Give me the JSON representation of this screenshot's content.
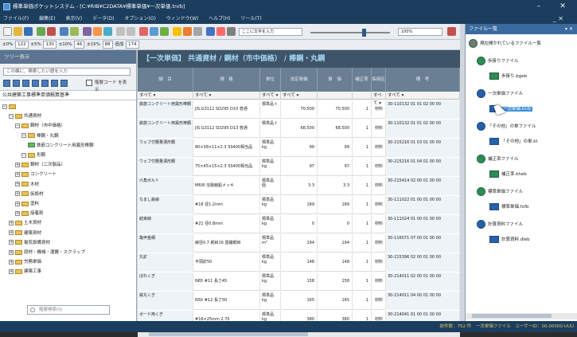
{
  "window": {
    "title": "標準単価ポケットシステム - [C:¥RIB¥C2DATA¥標準単価¥一次単価.tnrb]",
    "minimize": "–",
    "close": "✕"
  },
  "menu": [
    "ファイル(F)",
    "編集(E)",
    "表示(V)",
    "データ(D)",
    "オプション(O)",
    "ウィンドウ(W)",
    "ヘルプ(H)",
    "ツール(T)"
  ],
  "menu_close": "_ ✕",
  "toolbar": {
    "search_box": "ここに文字を入力",
    "zoom": "100%"
  },
  "toolbar2": {
    "items": [
      "±0%",
      "122",
      "±5%",
      "130",
      "±10%",
      "46",
      "±15%",
      "88",
      "追加",
      "174"
    ]
  },
  "left_pane": {
    "header": "ツリー表示",
    "filter_placeholder": "この欄に、検索したい語を入力",
    "filter_button": "検索",
    "code_checkbox_label": "階層コード を表示",
    "title": "公共建築工事標準単価積算基準",
    "search_placeholder": "階層検索(S)",
    "tree": [
      {
        "label": "",
        "level": 0,
        "kind": "root"
      },
      {
        "label": "共通資材",
        "level": 1,
        "kind": "folder"
      },
      {
        "label": "鋼材（市中価格）",
        "level": 2,
        "kind": "folder"
      },
      {
        "label": "棒鋼・丸鋼",
        "level": 3,
        "kind": "folder"
      },
      {
        "label": "鉄筋コンクリート用異形棒鋼",
        "level": 4,
        "kind": "leaf"
      },
      {
        "label": "形鋼",
        "level": 3,
        "kind": "folder"
      },
      {
        "label": "鋼材（二次製品）",
        "level": 2,
        "kind": "folder"
      },
      {
        "label": "コンクリート",
        "level": 2,
        "kind": "folder"
      },
      {
        "label": "木材",
        "level": 2,
        "kind": "folder"
      },
      {
        "label": "仮設材",
        "level": 2,
        "kind": "folder"
      },
      {
        "label": "塗料",
        "level": 2,
        "kind": "folder"
      },
      {
        "label": "接着剤",
        "level": 2,
        "kind": "folder"
      },
      {
        "label": "土木資材",
        "level": 1,
        "kind": "folder"
      },
      {
        "label": "建築資材",
        "level": 1,
        "kind": "folder"
      },
      {
        "label": "電気設備資材",
        "level": 1,
        "kind": "folder"
      },
      {
        "label": "原材・機械・運搬・スクラップ",
        "level": 1,
        "kind": "folder"
      },
      {
        "label": "労務単価",
        "level": 1,
        "kind": "folder"
      },
      {
        "label": "建築工事",
        "level": 1,
        "kind": "folder"
      }
    ]
  },
  "main": {
    "header": "【一次単価】 共通資材 / 鋼材（市中価格） / 棒鋼・丸鋼",
    "columns": [
      "細　目",
      "規　格",
      "単位",
      "決定単価",
      "単　価",
      "補正率",
      "採用区分",
      "備　考"
    ],
    "filters": [
      "すべて",
      "すべて",
      "すべて",
      "すべて",
      "",
      "",
      "すべて",
      "すべて"
    ],
    "rows": [
      {
        "name": "鉄筋コンクリート用異形棒鋼",
        "spec": "JIS G3112 SD295 D10 普通",
        "unit": "標準品 t",
        "decided": "70,500",
        "price": "70,500",
        "rate": "1",
        "adopt": "材料",
        "note": "30-110132 01 01 02 00 00"
      },
      {
        "name": "鉄筋コンクリート用異形棒鋼",
        "spec": "JIS G3112 SD295 D13 普通",
        "unit": "標準品 t",
        "decided": "68,500",
        "price": "68,500",
        "rate": "1",
        "adopt": "材料",
        "note": "30-110132 01 01 02 00 00"
      },
      {
        "name": "ウェブ付軽量溝形鋼",
        "spec": "80×38×11×2.3 SS400相当品",
        "unit": "標準品 kg",
        "decided": "99",
        "price": "99",
        "rate": "1",
        "adopt": "材料",
        "note": "30-215216 01 03 01 00 00"
      },
      {
        "name": "ウェブ付軽量溝形鋼",
        "spec": "75×45×15×2.3 SS400相当品",
        "unit": "標準品 kg",
        "decided": "97",
        "price": "97",
        "rate": "1",
        "adopt": "材料",
        "note": "30-215216 01 04 01 00 00"
      },
      {
        "name": "六角ボルト",
        "spec": "M6/8 溶融亜鉛メッキ",
        "unit": "標準品 個",
        "decided": "3.3",
        "price": "3.3",
        "rate": "1",
        "adopt": "材料",
        "note": "30-215414 02 00 01 00 00"
      },
      {
        "name": "なまし鉄線",
        "spec": "#18 径1.2mm",
        "unit": "標準品 kg",
        "decided": "189",
        "price": "189",
        "rate": "1",
        "adopt": "材料",
        "note": "30-111022 01 00 01 00 00"
      },
      {
        "name": "結束線",
        "spec": "#21 径0.8mm",
        "unit": "標準品 kg",
        "decided": "0",
        "price": "0",
        "rate": "1",
        "adopt": "材料",
        "note": "30-111024 01 00 01 00 00"
      },
      {
        "name": "亀甲金網",
        "spec": "線径0.7 網目16 基礎網目",
        "unit": "標準品 m²",
        "decided": "194",
        "price": "194",
        "rate": "1",
        "adopt": "材料",
        "note": "30-116071 07 00 01 00 00"
      },
      {
        "name": "丸釘",
        "spec": "平頭釘50",
        "unit": "標準品 kg",
        "decided": "148",
        "price": "148",
        "rate": "1",
        "adopt": "材料",
        "note": "30-215396 02 00 01 00 00"
      },
      {
        "name": "ぼれくぎ",
        "spec": "N65 #11 長さ45",
        "unit": "標準品 kg",
        "decided": "158",
        "price": "158",
        "rate": "1",
        "adopt": "材料",
        "note": "30-214011 02 00 01 00 00"
      },
      {
        "name": "鉄丸くぎ",
        "spec": "N50 #12 長さ50",
        "unit": "標準品 kg",
        "decided": "165",
        "price": "165",
        "rate": "1",
        "adopt": "材料",
        "note": "30-214011 04 00 01 00 00"
      },
      {
        "name": "ボード用くぎ",
        "spec": "#16×25mm 2.70",
        "unit": "標準品 kg",
        "decided": "380",
        "price": "380",
        "rate": "1",
        "adopt": "材料",
        "note": "30-214041 01 00 01 00 00"
      }
    ]
  },
  "right_pane": {
    "header": "ファイル一覧",
    "header_controls": "▾ ✕",
    "tree": [
      {
        "label": "現在開かれているファイル一覧",
        "kind": "root"
      },
      {
        "label": "歩掛りファイル",
        "kind": "group",
        "color": "green"
      },
      {
        "label": "歩掛り.bgeb",
        "kind": "file",
        "color": "green"
      },
      {
        "label": "一次単価ファイル",
        "kind": "group",
        "color": "blue"
      },
      {
        "label": "一次単価.tnrb",
        "kind": "file",
        "color": "blue",
        "selected": true
      },
      {
        "label": "「その他」の単ファイル",
        "kind": "group",
        "color": "blue"
      },
      {
        "label": "「その他」の単.kt",
        "kind": "file",
        "color": "blue"
      },
      {
        "label": "補正率ファイル",
        "kind": "group",
        "color": "green"
      },
      {
        "label": "補正率.kheb",
        "kind": "file",
        "color": "green"
      },
      {
        "label": "標準単価ファイル",
        "kind": "group",
        "color": "green"
      },
      {
        "label": "標準単価.fxfb",
        "kind": "file",
        "color": "blue"
      },
      {
        "label": "計算資料ファイル",
        "kind": "group",
        "color": "blue"
      },
      {
        "label": "計算資料.dleb",
        "kind": "file",
        "color": "blue"
      }
    ]
  },
  "status": "総件数：752 件　一次単価ファイル　ユーザーID：00-00000-UUU",
  "colors": {
    "accent": "#1b3d5e",
    "header": "#3e5468",
    "selected": "#3d8fd6"
  }
}
